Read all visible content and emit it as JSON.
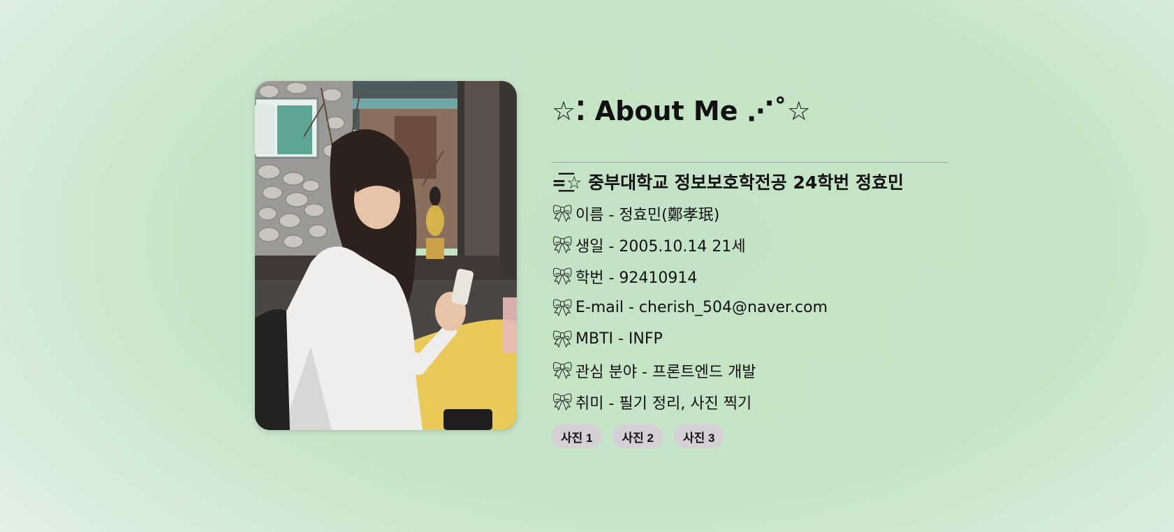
{
  "profile": {
    "title": "☆⁚ About Me ⋰˚☆",
    "subtitle": "=͟͟͞͞☆ 중부대학교 정보보호학전공 24학번 정효민",
    "bow_icon": "ribbon-icon",
    "rows": [
      {
        "text": "이름 - 정효민(鄭孝珉)"
      },
      {
        "text": "생일 - 2005.10.14 21세"
      },
      {
        "text": "학번 - 92410914"
      },
      {
        "text": "E-mail - cherish_504@naver.com"
      },
      {
        "text": "MBTI - INFP"
      },
      {
        "text": "관심 분야 - 프론트엔드 개발"
      },
      {
        "text": "취미 - 필기 정리, 사진 찍기"
      }
    ],
    "buttons": [
      "사진 1",
      "사진 2",
      "사진 3"
    ]
  },
  "colors": {
    "background": "#c4e3c6",
    "button": "#d5cfd6",
    "text": "#111111"
  }
}
